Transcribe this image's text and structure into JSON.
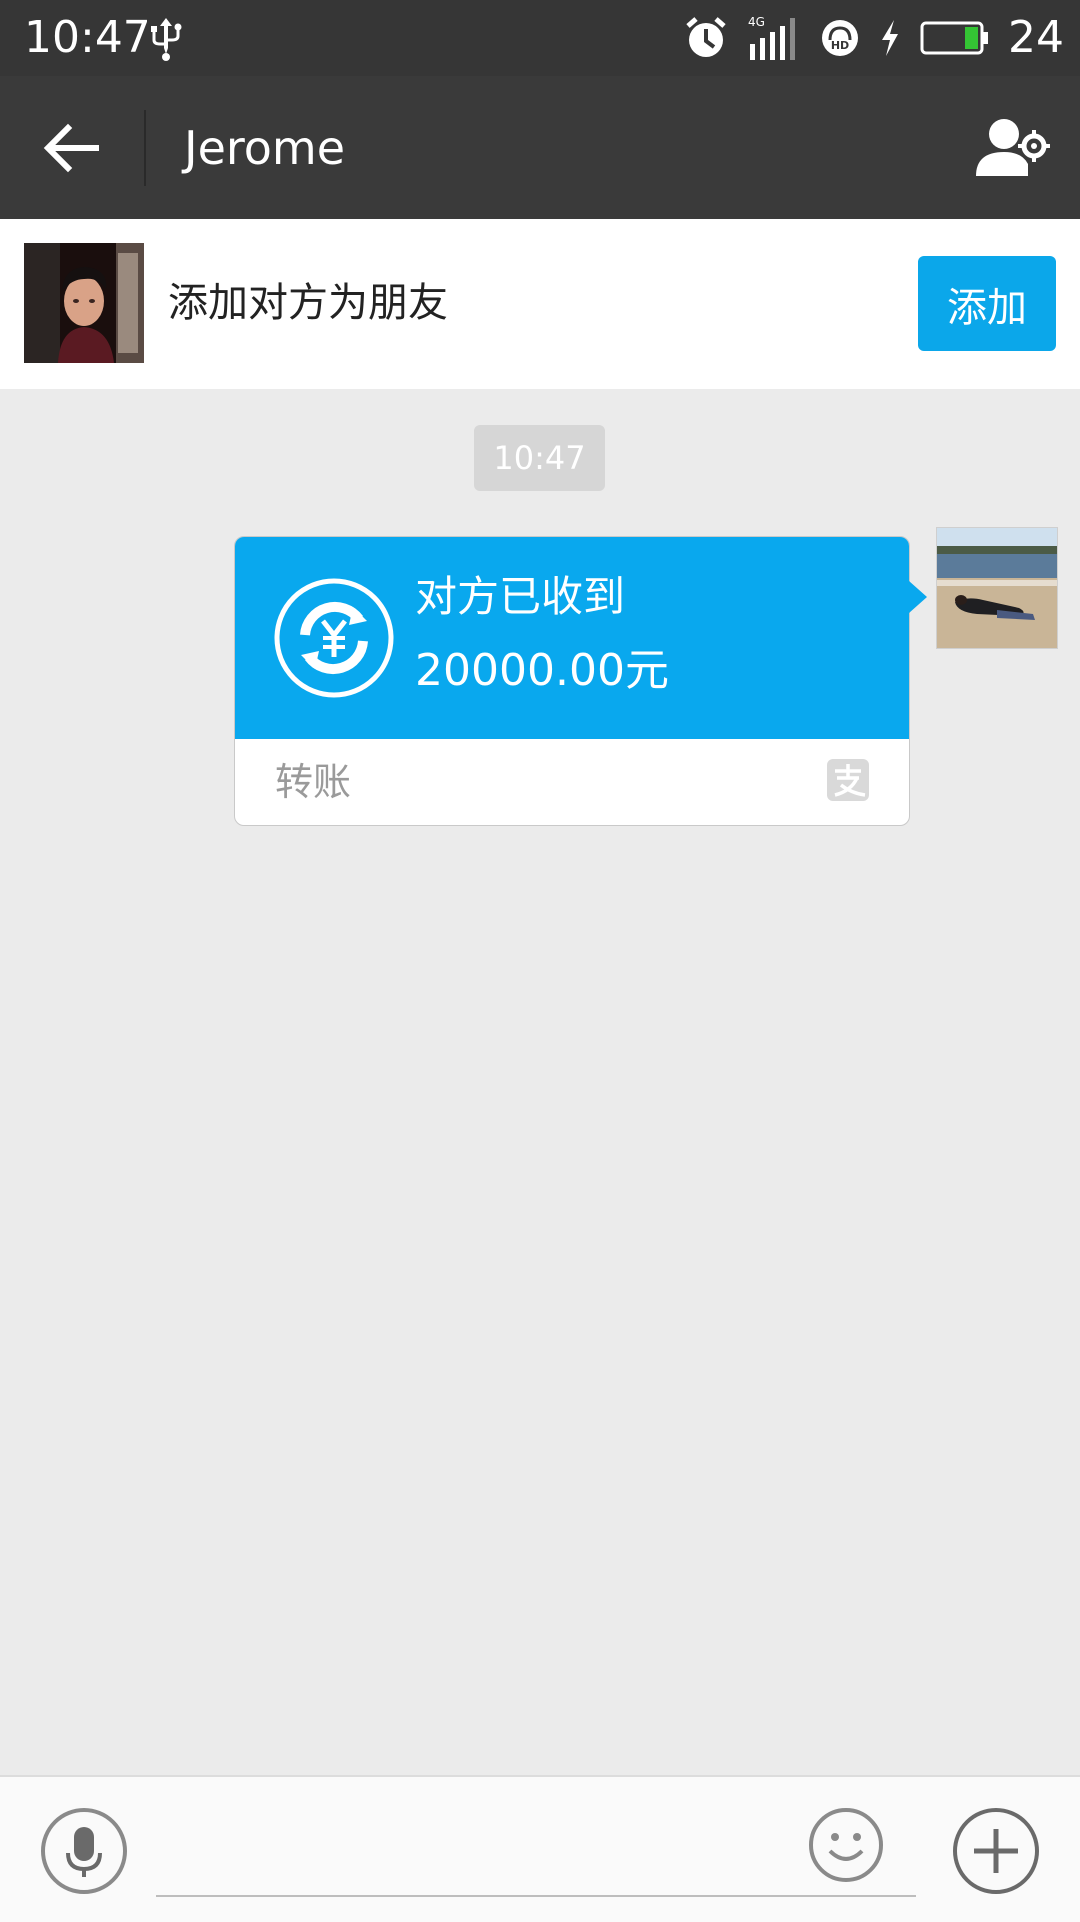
{
  "status_bar": {
    "time": "10:47",
    "network": "4G",
    "battery": "24",
    "icons": [
      "usb-icon",
      "alarm-icon",
      "signal-icon",
      "hd-voice-icon",
      "charging-icon",
      "battery-icon"
    ],
    "battery_level": 0.24
  },
  "nav": {
    "title": "Jerome",
    "back_icon": "back-arrow-icon",
    "profile_icon": "contact-settings-icon"
  },
  "add_friend": {
    "text": "添加对方为朋友",
    "button_label": "添加"
  },
  "chat": {
    "timestamp": "10:47",
    "transfer": {
      "status": "对方已收到",
      "amount": "20000.00元",
      "label": "转账",
      "icon": "yuan-transfer-icon",
      "brand_icon": "alipay-icon"
    }
  },
  "input_bar": {
    "placeholder": "",
    "icons": [
      "microphone-icon",
      "emoji-icon",
      "plus-icon"
    ]
  },
  "colors": {
    "accent": "#09a8ee",
    "header": "#3a3a3a",
    "status_bar": "#363636",
    "chat_bg": "#ebebeb"
  }
}
